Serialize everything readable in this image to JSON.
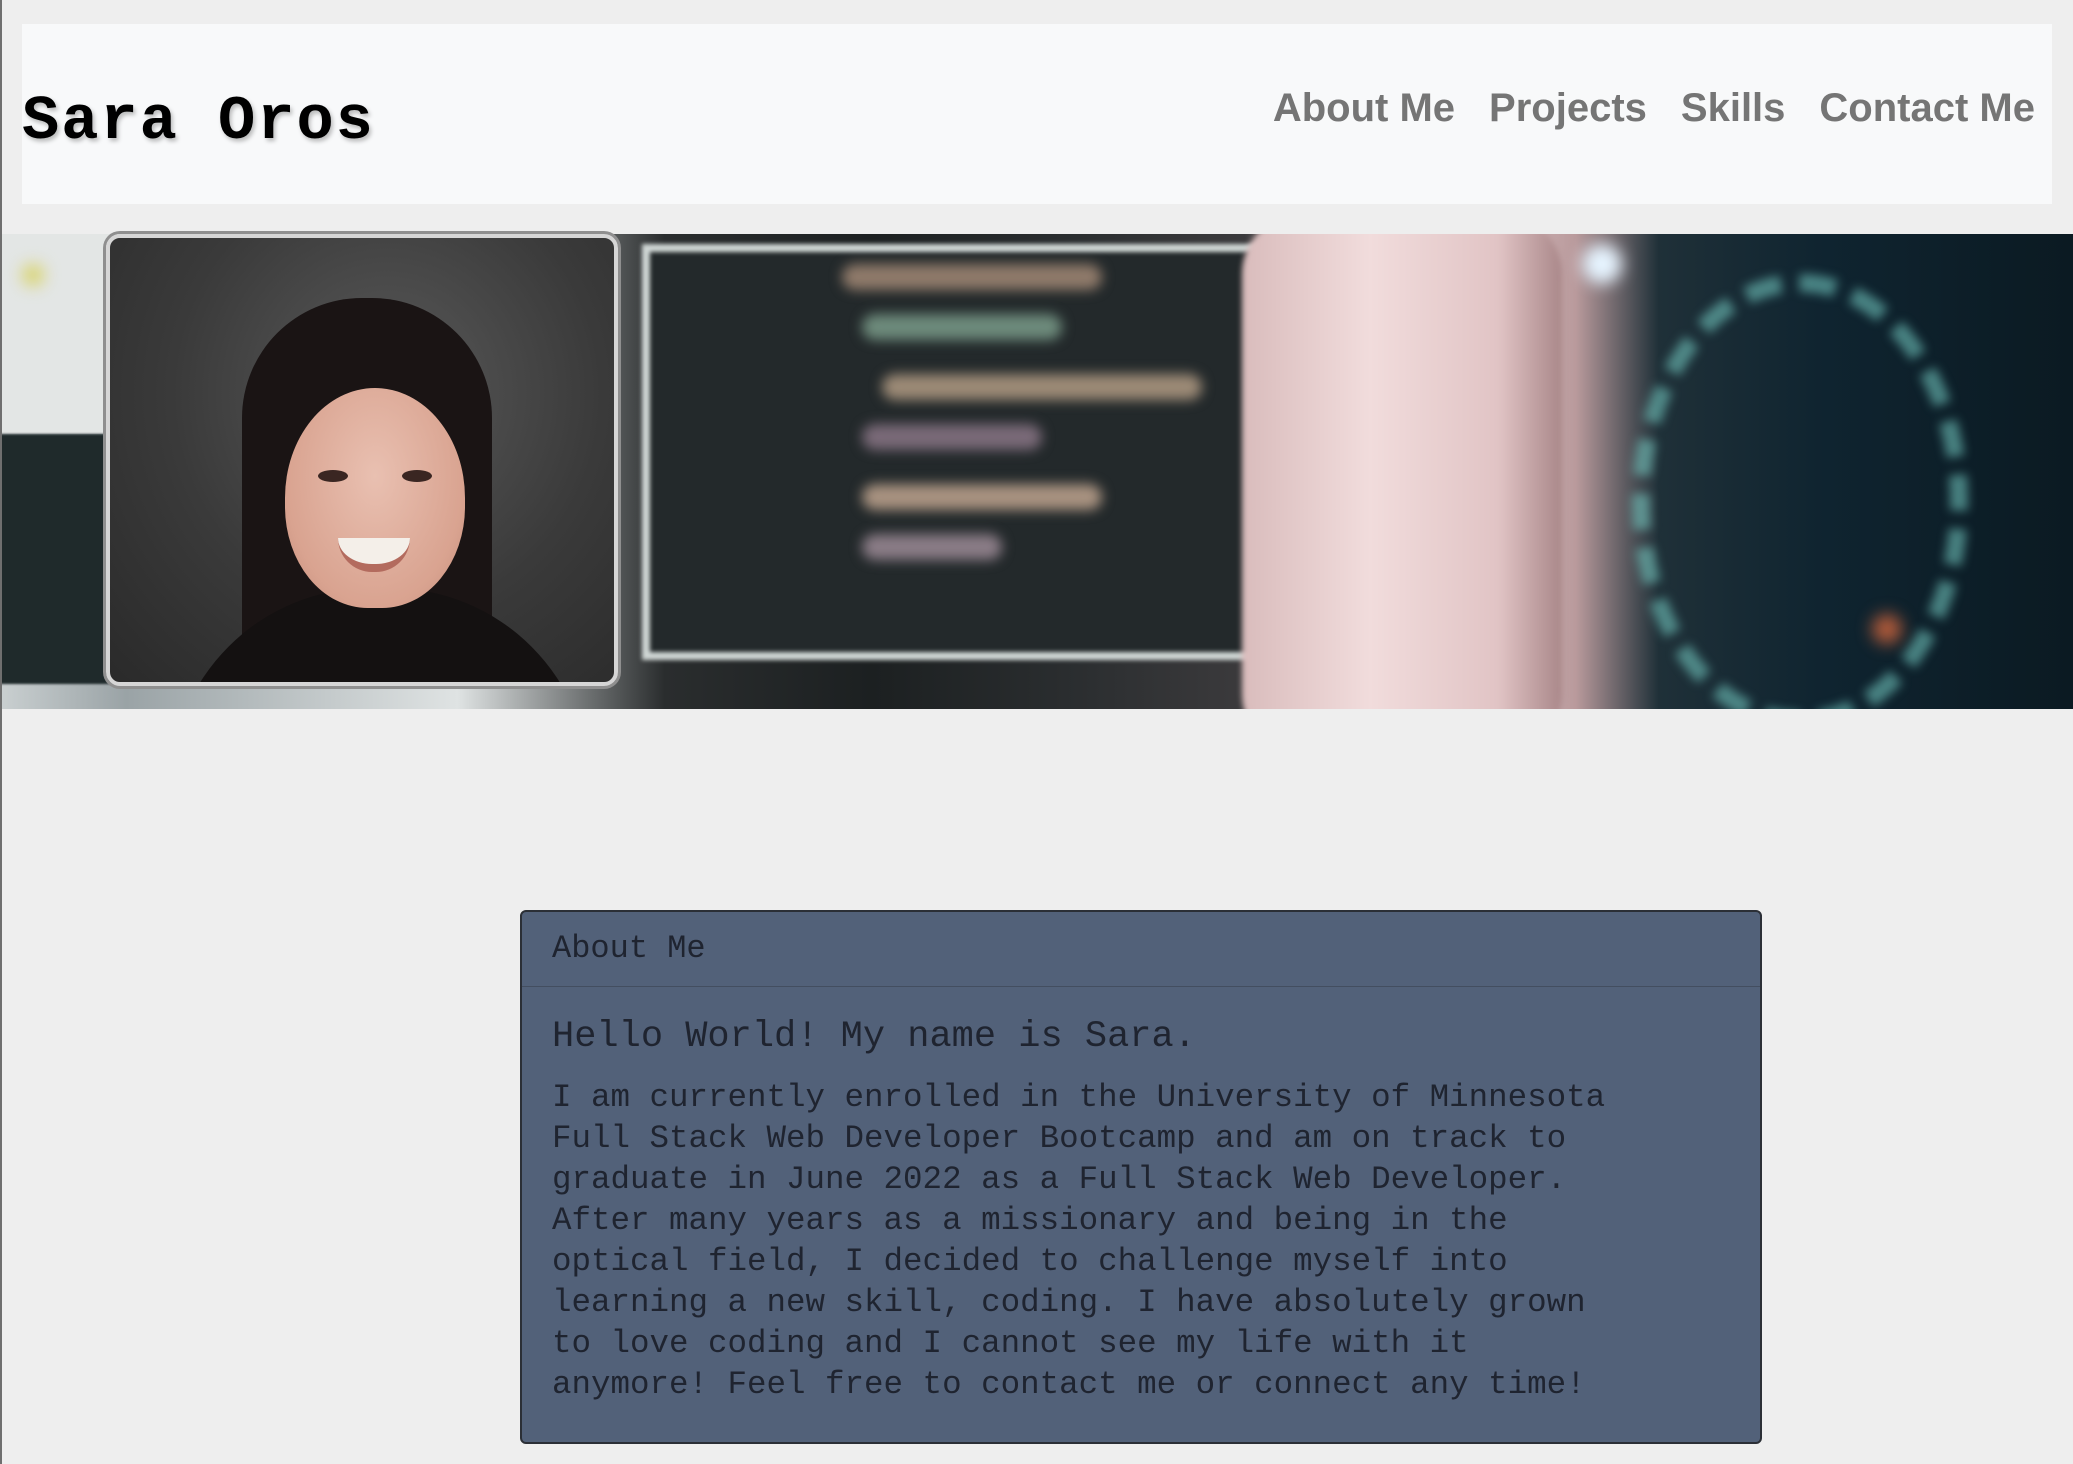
{
  "header": {
    "title": "Sara Oros",
    "nav": [
      {
        "label": "About Me"
      },
      {
        "label": "Projects"
      },
      {
        "label": "Skills"
      },
      {
        "label": "Contact Me"
      }
    ]
  },
  "about": {
    "card_title": "About Me",
    "heading": "Hello World! My name is Sara.",
    "text": "I am currently enrolled in the University of Minnesota\nFull Stack Web Developer Bootcamp and am on track to\ngraduate in June 2022 as a Full Stack Web Developer.\nAfter many years as a missionary and being in the\noptical field, I decided to challenge myself into\nlearning a new skill, coding. I have absolutely grown\nto love coding and I cannot see my life with it\nanymore! Feel free to contact me or connect any time!"
  },
  "colors": {
    "background": "#eeeeee",
    "header_bg": "#f8f9fa",
    "nav_link": "#757575",
    "card_bg": "#526179"
  }
}
